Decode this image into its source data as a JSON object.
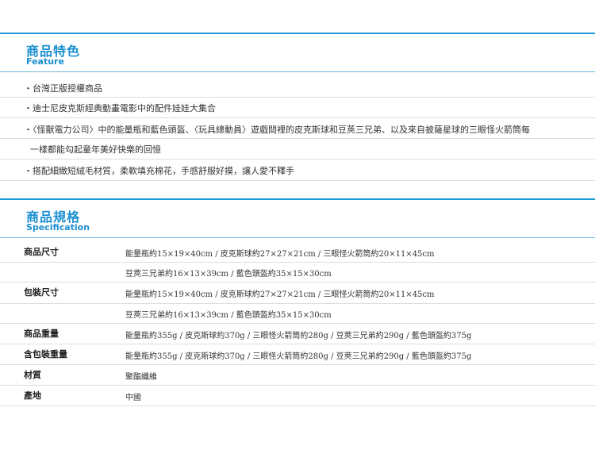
{
  "feature": {
    "title_zh": "商品特色",
    "title_en": "Feature",
    "items": [
      "・台灣正版授權商品",
      "・迪士尼皮克斯經典動畫電影中的配件娃娃大集合",
      "・〈怪獸電力公司〉中的能量瓶和藍色頭盔、〈玩具總動員〉遊戲間裡的皮克斯球和豆莢三兄弟、以及來自披薩星球的三眼怪火箭筒每",
      "一樣都能勾起童年美好快樂的回憶",
      "・搭配細緻短絨毛材質，柔軟填充棉花，手感舒服好摸，讓人愛不釋手"
    ]
  },
  "spec": {
    "title_zh": "商品規格",
    "title_en": "Specification",
    "rows": [
      {
        "label": "商品尺寸",
        "value": "能量瓶約15×19×40cm / 皮克斯球約27×27×21cm / 三眼怪火箭筒約20×11×45cm"
      },
      {
        "label": "",
        "value": "豆莢三兄弟約16×13×39cm / 藍色頭盔約35×15×30cm"
      },
      {
        "label": "包裝尺寸",
        "value": "能量瓶約15×19×40cm / 皮克斯球約27×27×21cm / 三眼怪火箭筒約20×11×45cm"
      },
      {
        "label": "",
        "value": "豆莢三兄弟約16×13×39cm / 藍色頭盔約35×15×30cm"
      },
      {
        "label": "商品重量",
        "value": "能量瓶約355g / 皮克斯球約370g / 三眼怪火箭筒約280g / 豆莢三兄弟約290g / 藍色頭盔約375g"
      },
      {
        "label": "含包裝重量",
        "value": "能量瓶約355g / 皮克斯球約370g / 三眼怪火箭筒約280g / 豆莢三兄弟約290g / 藍色頭盔約375g"
      },
      {
        "label": "材質",
        "value": "聚酯纖維"
      },
      {
        "label": "產地",
        "value": "中國"
      }
    ]
  },
  "colors": {
    "accent": "#1a8fd0",
    "divider": "#dddddd"
  }
}
